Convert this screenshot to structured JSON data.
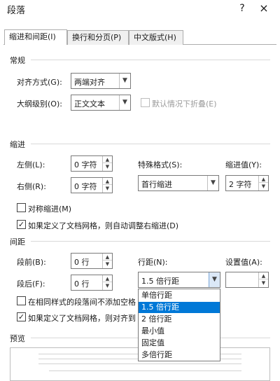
{
  "window": {
    "title": "段落",
    "help_icon": "?",
    "close_icon": "×"
  },
  "tabs": [
    {
      "label": "缩进和间距(I)",
      "active": true
    },
    {
      "label": "换行和分页(P)",
      "active": false
    },
    {
      "label": "中文版式(H)",
      "active": false
    }
  ],
  "general": {
    "title": "常规",
    "alignment": {
      "label": "对齐方式(G):",
      "value": "两端对齐"
    },
    "outline": {
      "label": "大纲级别(O):",
      "value": "正文文本"
    },
    "collapse_default": {
      "label": "默认情况下折叠(E)",
      "checked": false,
      "disabled": true
    }
  },
  "indent": {
    "title": "缩进",
    "left": {
      "label": "左侧(L):",
      "value": "0 字符"
    },
    "right": {
      "label": "右侧(R):",
      "value": "0 字符"
    },
    "special": {
      "label": "特殊格式(S):",
      "value": "首行缩进"
    },
    "by": {
      "label": "缩进值(Y):",
      "value": "2 字符"
    },
    "mirror": {
      "label": "对称缩进(M)",
      "checked": false
    },
    "auto_adjust": {
      "label": "如果定义了文档网格，则自动调整右缩进(D)",
      "checked": true
    }
  },
  "spacing": {
    "title": "间距",
    "before": {
      "label": "段前(B):",
      "value": "0 行"
    },
    "after": {
      "label": "段后(F):",
      "value": "0 行"
    },
    "line": {
      "label": "行距(N):",
      "value": "1.5 倍行距"
    },
    "at": {
      "label": "设置值(A):",
      "value": ""
    },
    "no_space_same_style": {
      "label": "在相同样式的段落间不添加空格",
      "checked": false
    },
    "snap_grid": {
      "label": "如果定义了文档网格，则对齐到",
      "checked": true
    },
    "line_options": [
      "单倍行距",
      "1.5 倍行距",
      "2 倍行距",
      "最小值",
      "固定值",
      "多倍行距"
    ],
    "line_selected_index": 1
  },
  "preview": {
    "title": "预览"
  },
  "icons": {
    "arrow": "chevron-down-icon",
    "spin_up": "triangle-up-icon",
    "spin_down": "triangle-down-icon",
    "check": "checkmark-icon"
  },
  "colors": {
    "selection": "#0078d7",
    "border": "#7a7a7a"
  }
}
